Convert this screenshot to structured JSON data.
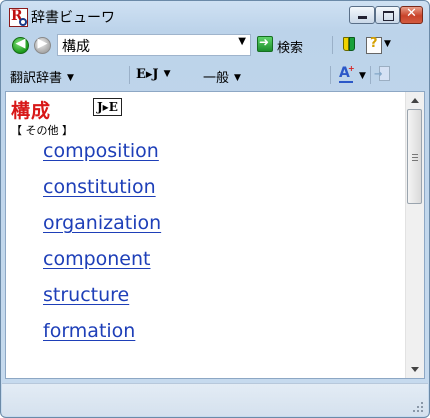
{
  "window": {
    "title": "辞書ビューワ",
    "close_glyph": "✕"
  },
  "toolbar1": {
    "back_glyph": "◀",
    "forward_glyph": "▶",
    "search_value": "構成",
    "search_placeholder": "",
    "dropdown_glyph": "▼",
    "go_glyph": "➜",
    "search_label": "検索",
    "help_glyph": "?"
  },
  "toolbar2": {
    "dictionary_type": "翻訳辞書",
    "direction": "E▸J",
    "field": "一般"
  },
  "entry": {
    "headword": "構成",
    "direction_badge": "J▸E",
    "category": "【 その他 】",
    "translations": [
      "composition",
      "constitution",
      "organization",
      "component",
      "structure",
      "formation"
    ]
  },
  "colors": {
    "headword": "#d81818",
    "link": "#1e3fb8",
    "window_bg": "#c7dbee"
  },
  "icons": {
    "app": "dictionary-viewer-icon",
    "back": "back-arrow-icon",
    "forward": "forward-arrow-icon",
    "go": "search-go-icon",
    "beginner": "beginner-mark-icon",
    "help": "help-icon",
    "font": "font-size-icon",
    "copy": "copy-icon"
  }
}
